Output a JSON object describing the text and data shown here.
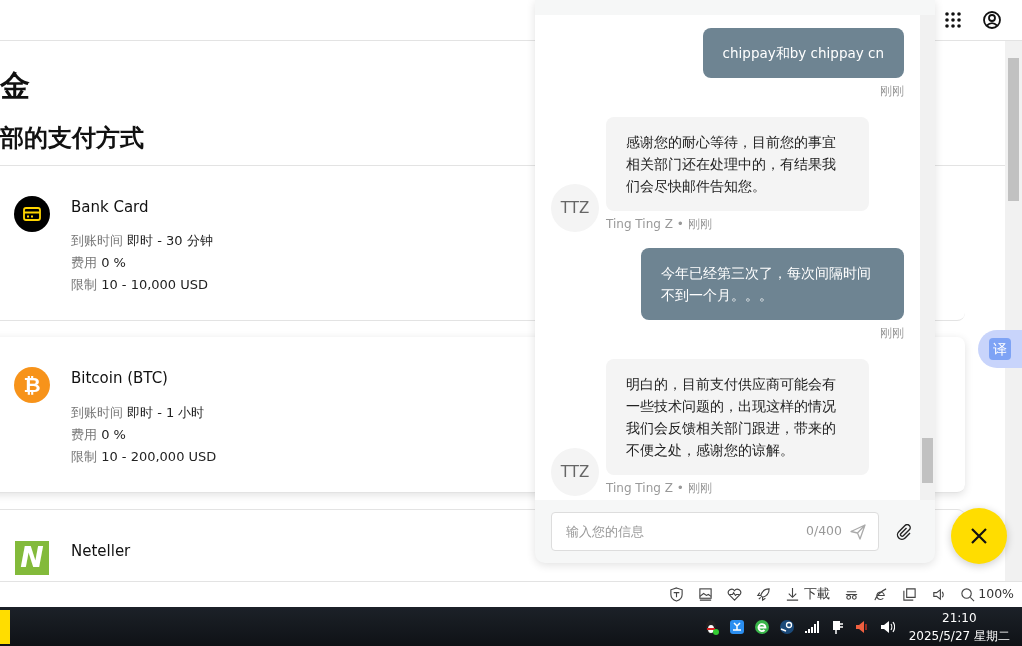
{
  "page": {
    "title": "金",
    "subtitle": "部的支付方式",
    "methods": [
      {
        "name": "Bank Card",
        "rows": [
          {
            "label": "到账时间",
            "value": "即时 - 30 分钟"
          },
          {
            "label": "费用",
            "value": "0 %"
          },
          {
            "label": "限制",
            "value": "10 - 10,000 USD"
          }
        ]
      },
      {
        "name": "Bitcoin (BTC)",
        "logo": "₿",
        "rows": [
          {
            "label": "到账时间",
            "value": "即时 - 1 小时"
          },
          {
            "label": "费用",
            "value": "0 %"
          },
          {
            "label": "限制",
            "value": "10 - 200,000 USD"
          }
        ]
      },
      {
        "name": "Neteller",
        "logo": "N"
      }
    ]
  },
  "chat": {
    "messages": [
      {
        "kind": "sent",
        "text": "chippay和by chippay cn",
        "meta": "刚刚"
      },
      {
        "kind": "received",
        "avatar": "TTZ",
        "text": "感谢您的耐心等待，目前您的事宜相关部门还在处理中的，有结果我们会尽快邮件告知您。",
        "meta": "Ting Ting Z • 刚刚"
      },
      {
        "kind": "sent",
        "text": "今年已经第三次了，每次间隔时间不到一个月。。。",
        "meta": "刚刚"
      },
      {
        "kind": "received",
        "avatar": "TTZ",
        "text": "明白的，目前支付供应商可能会有一些技术问题的，出现这样的情况我们会反馈相关部门跟进，带来的不便之处，感谢您的谅解。",
        "meta": "Ting Ting Z • 刚刚"
      }
    ],
    "input": {
      "placeholder": "输入您的信息",
      "counter": "0/400"
    }
  },
  "translate": {
    "label": "译"
  },
  "statusbar": {
    "download": "下載",
    "zoom": "100%"
  },
  "taskbar": {
    "time": "21:10",
    "date": "2025/5/27 星期二"
  }
}
